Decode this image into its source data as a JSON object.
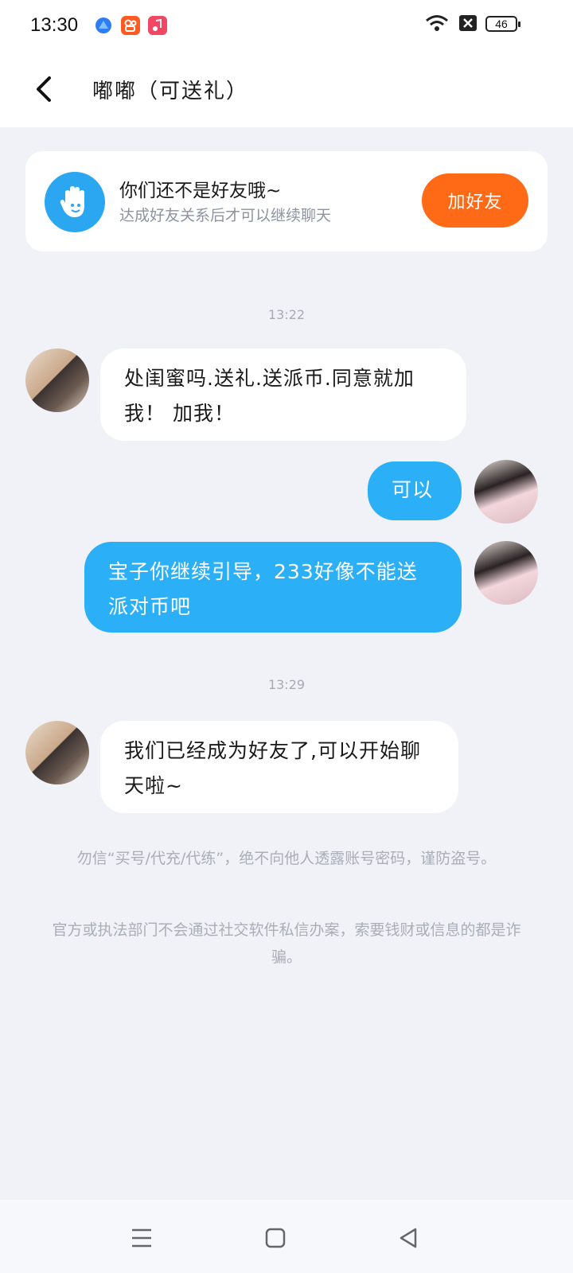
{
  "status_bar": {
    "time": "13:30",
    "battery": "46",
    "apps": [
      "blue-app-icon",
      "kuaishou-icon",
      "music-icon"
    ]
  },
  "header": {
    "back_icon": "chevron-left-icon",
    "title": "嘟嘟（可送礼）"
  },
  "friend_card": {
    "title": "你们还不是好友哦~",
    "subtitle": "达成好友关系后才可以继续聊天",
    "add_button": "加好友"
  },
  "messages": [
    {
      "timestamp": "13:22"
    },
    {
      "side": "left",
      "text": "处闺蜜吗.送礼.送派币.同意就加我！ 加我！"
    },
    {
      "side": "right",
      "text": "可以"
    },
    {
      "side": "right",
      "text": "宝子你继续引导，233好像不能送派对币吧"
    },
    {
      "timestamp": "13:29"
    },
    {
      "side": "left",
      "text": "我们已经成为好友了,可以开始聊天啦~"
    }
  ],
  "notices": [
    "勿信“买号/代充/代练”，绝不向他人透露账号密码，谨防盗号。",
    "官方或执法部门不会通过社交软件私信办案，索要钱财或信息的都是诈骗。"
  ],
  "colors": {
    "background": "#f0f2f7",
    "outgoing_bubble": "#2bb0f8",
    "add_button": "#ff6a16",
    "hand_circle": "#2ba6f0"
  },
  "system_nav": [
    "menu-icon",
    "home-icon",
    "back-triangle-icon"
  ]
}
